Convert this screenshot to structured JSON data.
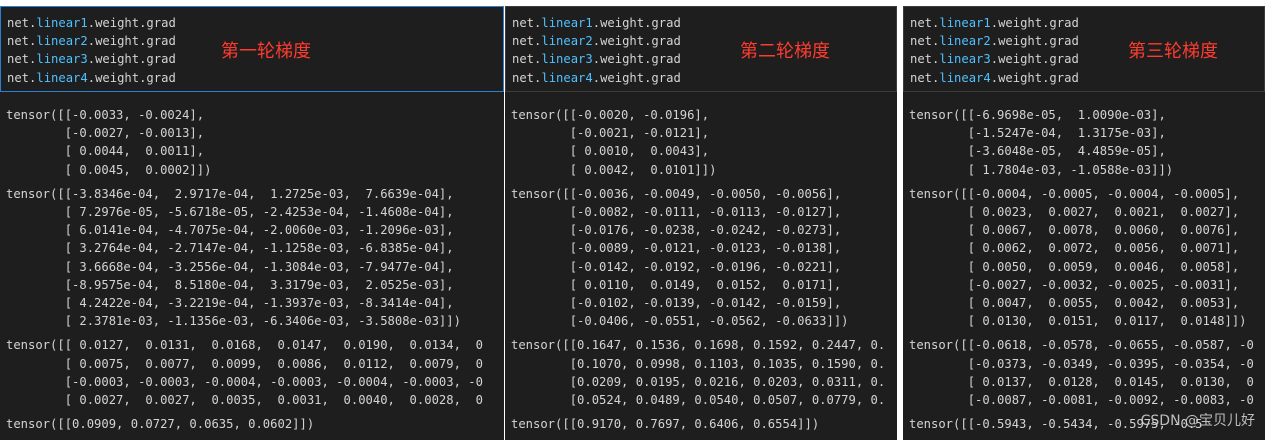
{
  "panels": [
    {
      "code": [
        {
          "obj": "net.",
          "attr": "linear1",
          "rest": ".weight.grad"
        },
        {
          "obj": "net.",
          "attr": "linear2",
          "rest": ".weight.grad"
        },
        {
          "obj": "net.",
          "attr": "linear3",
          "rest": ".weight.grad"
        },
        {
          "obj": "net.",
          "attr": "linear4",
          "rest": ".weight.grad"
        }
      ],
      "label": "第一轮梯度",
      "outputs": [
        [
          "tensor([[-0.0033, -0.0024],",
          "        [-0.0027, -0.0013],",
          "        [ 0.0044,  0.0011],",
          "        [ 0.0045,  0.0002]])"
        ],
        [
          "tensor([[-3.8346e-04,  2.9717e-04,  1.2725e-03,  7.6639e-04],",
          "        [ 7.2976e-05, -5.6718e-05, -2.4253e-04, -1.4608e-04],",
          "        [ 6.0141e-04, -4.7075e-04, -2.0060e-03, -1.2096e-03],",
          "        [ 3.2764e-04, -2.7147e-04, -1.1258e-03, -6.8385e-04],",
          "        [ 3.6668e-04, -3.2556e-04, -1.3084e-03, -7.9477e-04],",
          "        [-8.9575e-04,  8.5180e-04,  3.3179e-03,  2.0525e-03],",
          "        [ 4.2422e-04, -3.2219e-04, -1.3937e-03, -8.3414e-04],",
          "        [ 2.3781e-03, -1.1356e-03, -6.3406e-03, -3.5808e-03]])"
        ],
        [
          "tensor([[ 0.0127,  0.0131,  0.0168,  0.0147,  0.0190,  0.0134,  0",
          "        [ 0.0075,  0.0077,  0.0099,  0.0086,  0.0112,  0.0079,  0",
          "        [-0.0003, -0.0003, -0.0004, -0.0003, -0.0004, -0.0003, -0",
          "        [ 0.0027,  0.0027,  0.0035,  0.0031,  0.0040,  0.0028,  0"
        ],
        [
          "tensor([[0.0909, 0.0727, 0.0635, 0.0602]])"
        ]
      ]
    },
    {
      "code": [
        {
          "obj": "net.",
          "attr": "linear1",
          "rest": ".weight.grad"
        },
        {
          "obj": "net.",
          "attr": "linear2",
          "rest": ".weight.grad"
        },
        {
          "obj": "net.",
          "attr": "linear3",
          "rest": ".weight.grad"
        },
        {
          "obj": "net.",
          "attr": "linear4",
          "rest": ".weight.grad"
        }
      ],
      "label": "第二轮梯度",
      "outputs": [
        [
          "tensor([[-0.0020, -0.0196],",
          "        [-0.0021, -0.0121],",
          "        [ 0.0010,  0.0043],",
          "        [ 0.0042,  0.0101]])"
        ],
        [
          "tensor([[-0.0036, -0.0049, -0.0050, -0.0056],",
          "        [-0.0082, -0.0111, -0.0113, -0.0127],",
          "        [-0.0176, -0.0238, -0.0242, -0.0273],",
          "        [-0.0089, -0.0121, -0.0123, -0.0138],",
          "        [-0.0142, -0.0192, -0.0196, -0.0221],",
          "        [ 0.0110,  0.0149,  0.0152,  0.0171],",
          "        [-0.0102, -0.0139, -0.0142, -0.0159],",
          "        [-0.0406, -0.0551, -0.0562, -0.0633]])"
        ],
        [
          "tensor([[0.1647, 0.1536, 0.1698, 0.1592, 0.2447, 0.",
          "        [0.1070, 0.0998, 0.1103, 0.1035, 0.1590, 0.",
          "        [0.0209, 0.0195, 0.0216, 0.0203, 0.0311, 0.",
          "        [0.0524, 0.0489, 0.0540, 0.0507, 0.0779, 0."
        ],
        [
          "tensor([[0.9170, 0.7697, 0.6406, 0.6554]])"
        ]
      ]
    },
    {
      "code": [
        {
          "obj": "net.",
          "attr": "linear1",
          "rest": ".weight.grad"
        },
        {
          "obj": "net.",
          "attr": "linear2",
          "rest": ".weight.grad"
        },
        {
          "obj": "net.",
          "attr": "linear3",
          "rest": ".weight.grad"
        },
        {
          "obj": "net.",
          "attr": "linear4",
          "rest": ".weight.grad"
        }
      ],
      "label": "第三轮梯度",
      "outputs": [
        [
          "tensor([[-6.9698e-05,  1.0090e-03],",
          "        [-1.5247e-04,  1.3175e-03],",
          "        [-3.6048e-05,  4.4859e-05],",
          "        [ 1.7804e-03, -1.0588e-03]])"
        ],
        [
          "tensor([[-0.0004, -0.0005, -0.0004, -0.0005],",
          "        [ 0.0023,  0.0027,  0.0021,  0.0027],",
          "        [ 0.0067,  0.0078,  0.0060,  0.0076],",
          "        [ 0.0062,  0.0072,  0.0056,  0.0071],",
          "        [ 0.0050,  0.0059,  0.0046,  0.0058],",
          "        [-0.0027, -0.0032, -0.0025, -0.0031],",
          "        [ 0.0047,  0.0055,  0.0042,  0.0053],",
          "        [ 0.0130,  0.0151,  0.0117,  0.0148]])"
        ],
        [
          "tensor([[-0.0618, -0.0578, -0.0655, -0.0587, -0",
          "        [-0.0373, -0.0349, -0.0395, -0.0354, -0",
          "        [ 0.0137,  0.0128,  0.0145,  0.0130,  0",
          "        [-0.0087, -0.0081, -0.0092, -0.0083, -0"
        ],
        [
          "tensor([[-0.5943, -0.5434, -0.5975, -0.5"
        ]
      ]
    }
  ],
  "watermark": "CSDN @宝贝儿好"
}
